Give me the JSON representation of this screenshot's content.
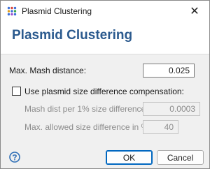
{
  "window": {
    "title": "Plasmid Clustering",
    "close_glyph": "✕"
  },
  "header": {
    "title": "Plasmid Clustering"
  },
  "form": {
    "max_mash_label": "Max. Mash distance:",
    "max_mash_value": "0.025",
    "compensation_label": "Use plasmid size difference compensation:",
    "compensation_checked": false,
    "mash_per_pct_label": "Mash dist per 1% size difference:",
    "mash_per_pct_value": "0.0003",
    "max_size_diff_label": "Max. allowed size difference in %:",
    "max_size_diff_value": "40"
  },
  "footer": {
    "ok_label": "OK",
    "cancel_label": "Cancel"
  },
  "colors": {
    "header_title": "#2b5a8e",
    "help_icon": "#2f6fb6",
    "default_button_border": "#0067c0"
  },
  "icons": {
    "app": "dot-grid-app-icon",
    "close": "close-icon",
    "help": "help-icon"
  }
}
